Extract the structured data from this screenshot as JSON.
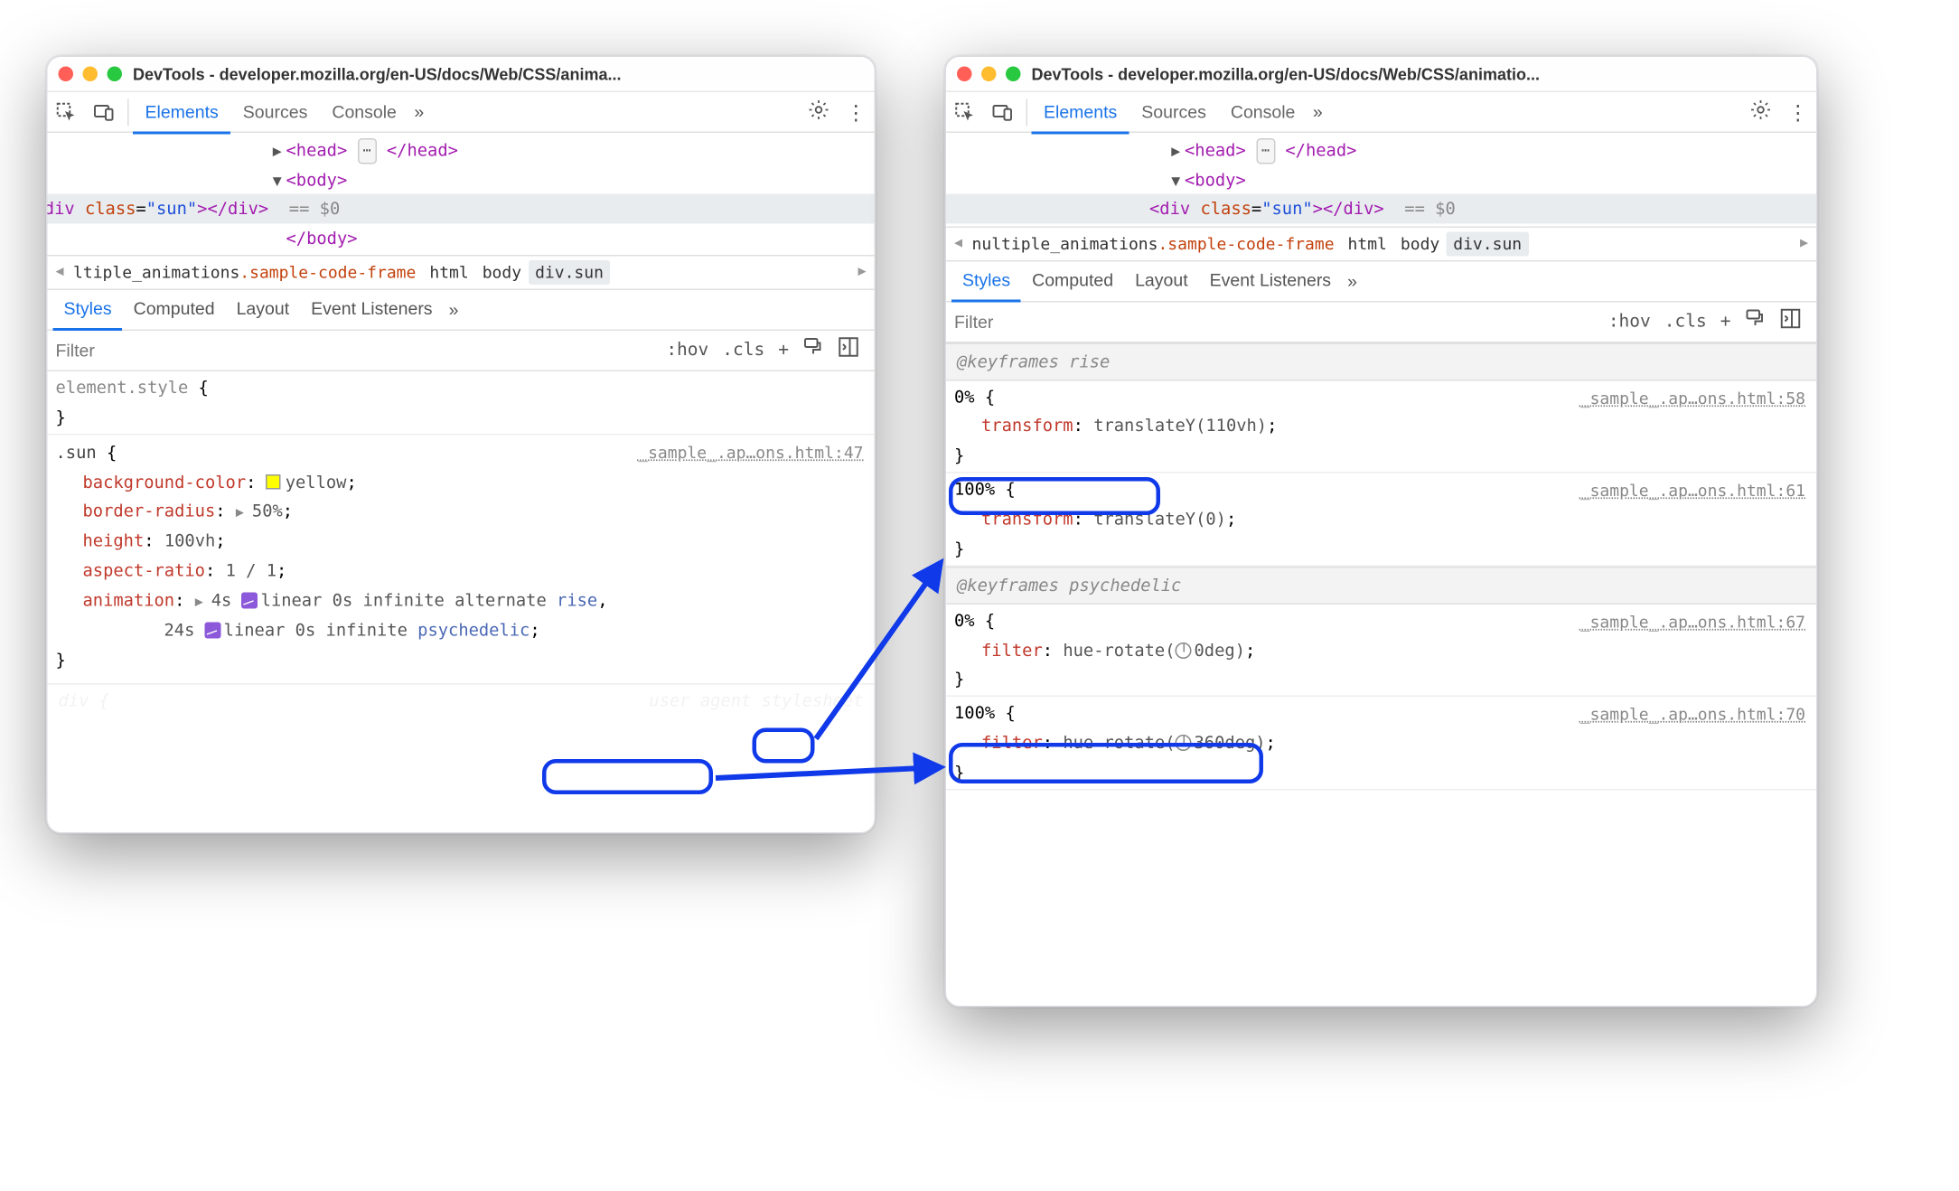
{
  "left": {
    "title": "DevTools - developer.mozilla.org/en-US/docs/Web/CSS/anima...",
    "tabs": {
      "elements": "Elements",
      "sources": "Sources",
      "console": "Console"
    },
    "dom": {
      "head_open": "<head>",
      "head_close": "</head>",
      "body_open": "<body>",
      "body_close": "</body>",
      "div_open": "<div ",
      "div_close": "</div>",
      "class_attr": "class",
      "class_val": "\"sun\"",
      "selected": "== $0"
    },
    "crumb": {
      "prefix": "ltiple_animations",
      "frame": ".sample-code-frame",
      "html": "html",
      "body": "body",
      "sun": "div.sun"
    },
    "subpanels": {
      "styles": "Styles",
      "computed": "Computed",
      "layout": "Layout",
      "listeners": "Event Listeners"
    },
    "filter": {
      "placeholder": "Filter",
      "hov": ":hov",
      "cls": ".cls",
      "plus": "+"
    },
    "rules": {
      "elemStyle": "element.style",
      "sun": ".sun",
      "sunSource": "_sample_.ap…ons.html:47",
      "bg": {
        "name": "background-color",
        "value": "yellow"
      },
      "br": {
        "name": "border-radius",
        "value": "50%"
      },
      "h": {
        "name": "height",
        "value": "100vh"
      },
      "ar": {
        "name": "aspect-ratio",
        "value": "1 / 1"
      },
      "anim": {
        "name": "animation",
        "p1": "4s",
        "ease1": "linear 0s infinite alternate",
        "rise": "rise",
        "p2": "24s",
        "ease2": "linear 0s infinite",
        "psy": "psychedelic"
      }
    }
  },
  "right": {
    "title": "DevTools - developer.mozilla.org/en-US/docs/Web/CSS/animatio...",
    "crumb": {
      "prefix": "nultiple_animations",
      "frame": ".sample-code-frame",
      "html": "html",
      "body": "body",
      "sun": "div.sun"
    },
    "filter": {
      "placeholder": "Filter",
      "hov": ":hov",
      "cls": ".cls",
      "plus": "+"
    },
    "kf": {
      "riseHeader": "@keyframes rise",
      "rise0": {
        "sel": "0% {",
        "src": "_sample_.ap…ons.html:58",
        "name": "transform",
        "val": "translateY(110vh)"
      },
      "rise100": {
        "sel": "100% {",
        "src": "_sample_.ap…ons.html:61",
        "name": "transform",
        "val": "translateY(0)"
      },
      "psyHeader": "@keyframes psychedelic",
      "psy0": {
        "sel": "0% {",
        "src": "_sample_.ap…ons.html:67",
        "name": "filter",
        "fn": "hue-rotate(",
        "deg": "0deg",
        "close": ")"
      },
      "psy100": {
        "sel": "100% {",
        "src": "_sample_.ap…ons.html:70",
        "name": "filter",
        "fn": "hue-rotate(",
        "deg": "360deg",
        "close": ")"
      }
    }
  }
}
